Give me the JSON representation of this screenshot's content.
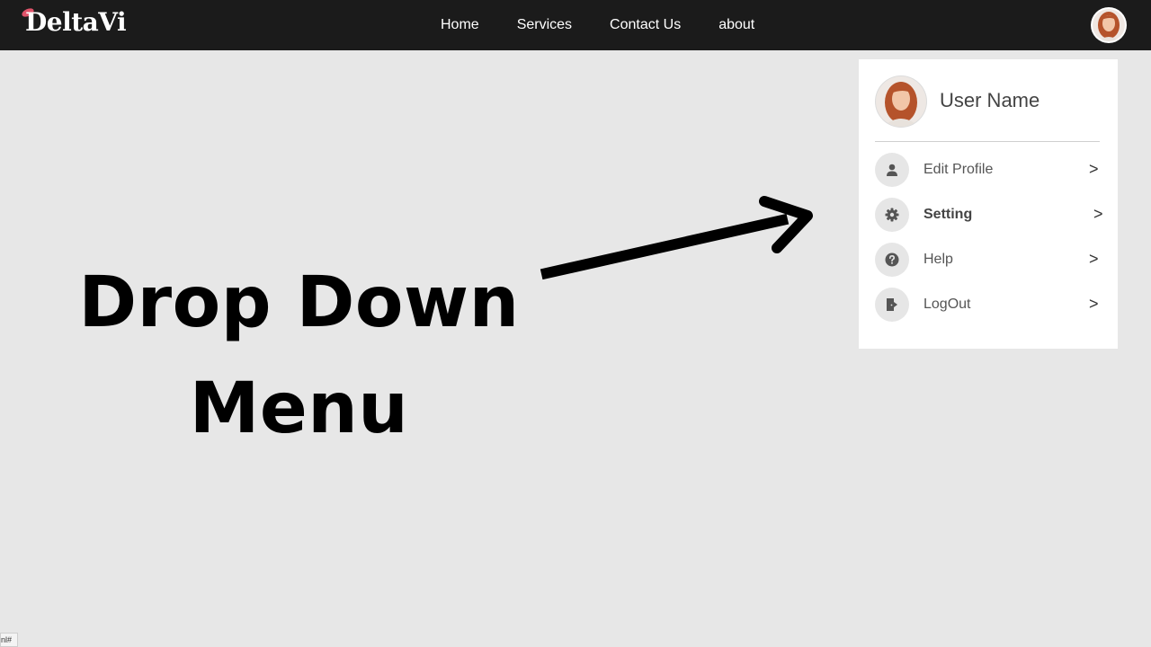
{
  "brand": {
    "name": "DeltaVi",
    "accent_color": "#e0536a"
  },
  "nav": {
    "links": [
      "Home",
      "Services",
      "Contact Us",
      "about"
    ],
    "avatar_icon": "user-avatar-photo"
  },
  "hero": {
    "line1": "Drop Down",
    "line2": "Menu"
  },
  "dropdown": {
    "user_name": "User Name",
    "items": [
      {
        "label": "Edit Profile",
        "icon": "person-icon",
        "chevron": ">"
      },
      {
        "label": "Setting",
        "icon": "gear-icon",
        "chevron": ">"
      },
      {
        "label": "Help",
        "icon": "question-icon",
        "chevron": ">"
      },
      {
        "label": "LogOut",
        "icon": "logout-icon",
        "chevron": ">"
      }
    ]
  },
  "status_bar": {
    "url_fragment": "nl#"
  },
  "colors": {
    "navbar": "#1b1b1b",
    "page_bg": "#e7e7e7",
    "panel_bg": "#ffffff",
    "icon_bg": "#e6e6e6"
  }
}
